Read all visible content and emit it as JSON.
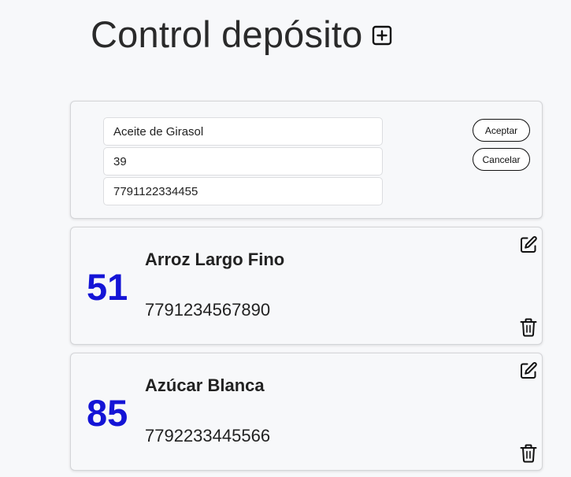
{
  "header": {
    "title": "Control depósito"
  },
  "form": {
    "name_value": "Aceite de Girasol",
    "quantity_value": "39",
    "code_value": "7791122334455",
    "accept_label": "Aceptar",
    "cancel_label": "Cancelar"
  },
  "items": [
    {
      "quantity": "51",
      "name": "Arroz Largo Fino",
      "code": "7791234567890"
    },
    {
      "quantity": "85",
      "name": "Azúcar Blanca",
      "code": "7792233445566"
    }
  ],
  "icons": {
    "add": "plus-square-icon",
    "edit": "pencil-square-icon",
    "delete": "trash-icon"
  },
  "colors": {
    "quantity": "#1414d6",
    "background": "#f7f8fa",
    "text": "#222222"
  }
}
